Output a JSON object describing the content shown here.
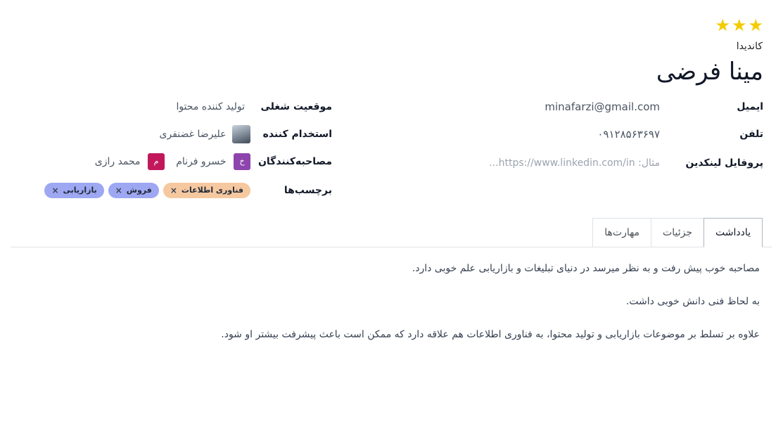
{
  "header": {
    "stars": [
      "star",
      "star",
      "star"
    ],
    "subtitle": "کاندیدا",
    "name": "مینا فرضی"
  },
  "left_fields": {
    "email_label": "ایمیل",
    "email_value": "minafarzi@gmail.com",
    "phone_label": "تلفن",
    "phone_value": "۰۹۱۲۸۵۶۳۶۹۷",
    "linkedin_label": "پروفایل لینکدین",
    "linkedin_placeholder": "مثال: https://www.linkedin.com/in..."
  },
  "right_fields": {
    "job_label": "موقعیت شغلی",
    "job_value": "تولید کننده محتوا",
    "recruiter_label": "استخدام کننده",
    "recruiter_value": "علیرضا غضنفری",
    "interviewers_label": "مصاحبه‌کنندگان",
    "interviewers": [
      {
        "initial": "خ",
        "name": "خسرو فرنام",
        "color": "#8e44ad"
      },
      {
        "initial": "م",
        "name": "محمد رازی",
        "color": "#c2185b"
      }
    ],
    "tags_label": "برچسب‌ها",
    "tags": [
      {
        "label": "فناوری اطلاعات",
        "color": "#f6c8a0"
      },
      {
        "label": "فروش",
        "color": "#9ea7f2"
      },
      {
        "label": "بازاریابی",
        "color": "#9ea7f2"
      }
    ],
    "tag_remove_symbol": "×"
  },
  "tabs": [
    {
      "label": "یادداشت",
      "active": true
    },
    {
      "label": "جزئیات",
      "active": false
    },
    {
      "label": "مهارت‌ها",
      "active": false
    }
  ],
  "notes": [
    "مصاحبه خوب پیش رفت و به نظر میرسد در دنیای تبلیغات و بازاریابی علم خوبی دارد.",
    "به لحاظ فنی دانش خوبی داشت.",
    "علاوه بر تسلط بر موضوعات بازاریابی و تولید محتوا، به فناوری اطلاعات هم علاقه دارد که ممکن است باعث پیشرفت بیشتر او شود."
  ]
}
